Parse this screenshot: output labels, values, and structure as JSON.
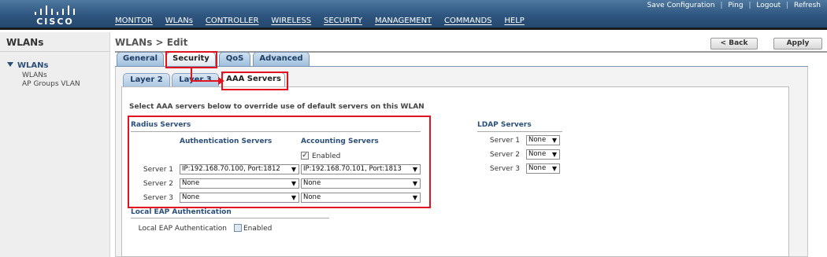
{
  "brand": {
    "logo_text": "CISCO"
  },
  "header": {
    "nav": [
      "MONITOR",
      "WLANs",
      "CONTROLLER",
      "WIRELESS",
      "SECURITY",
      "MANAGEMENT",
      "COMMANDS",
      "HELP"
    ],
    "links": {
      "save": "Save Configuration",
      "ping": "Ping",
      "logout": "Logout",
      "refresh": "Refresh"
    }
  },
  "sidebar": {
    "title": "WLANs",
    "group": "WLANs",
    "items": [
      "WLANs",
      "AP Groups VLAN"
    ]
  },
  "main": {
    "title": "WLANs > Edit",
    "back_label": "< Back",
    "apply_label": "Apply",
    "tabs": [
      "General",
      "Security",
      "QoS",
      "Advanced"
    ],
    "subtabs": [
      "Layer 2",
      "Layer 3",
      "AAA Servers"
    ],
    "instruction": "Select AAA servers below to override use of default servers on this WLAN",
    "radius": {
      "title": "Radius Servers",
      "auth_header": "Authentication Servers",
      "acct_header": "Accounting Servers",
      "enabled_label": "Enabled",
      "enabled": true,
      "rows": [
        {
          "label": "Server 1",
          "auth": "IP:192.168.70.100, Port:1812",
          "acct": "IP:192.168.70.101, Port:1813"
        },
        {
          "label": "Server 2",
          "auth": "None",
          "acct": "None"
        },
        {
          "label": "Server 3",
          "auth": "None",
          "acct": "None"
        }
      ]
    },
    "ldap": {
      "title": "LDAP Servers",
      "rows": [
        {
          "label": "Server 1",
          "value": "None"
        },
        {
          "label": "Server 2",
          "value": "None"
        },
        {
          "label": "Server 3",
          "value": "None"
        }
      ]
    },
    "eap": {
      "title": "Local EAP Authentication",
      "label": "Local EAP Authentication",
      "enabled_label": "Enabled",
      "enabled": false
    }
  },
  "colors": {
    "header": "#2f5680",
    "accent": "#2b4f7b",
    "highlight": "#e2121e"
  }
}
